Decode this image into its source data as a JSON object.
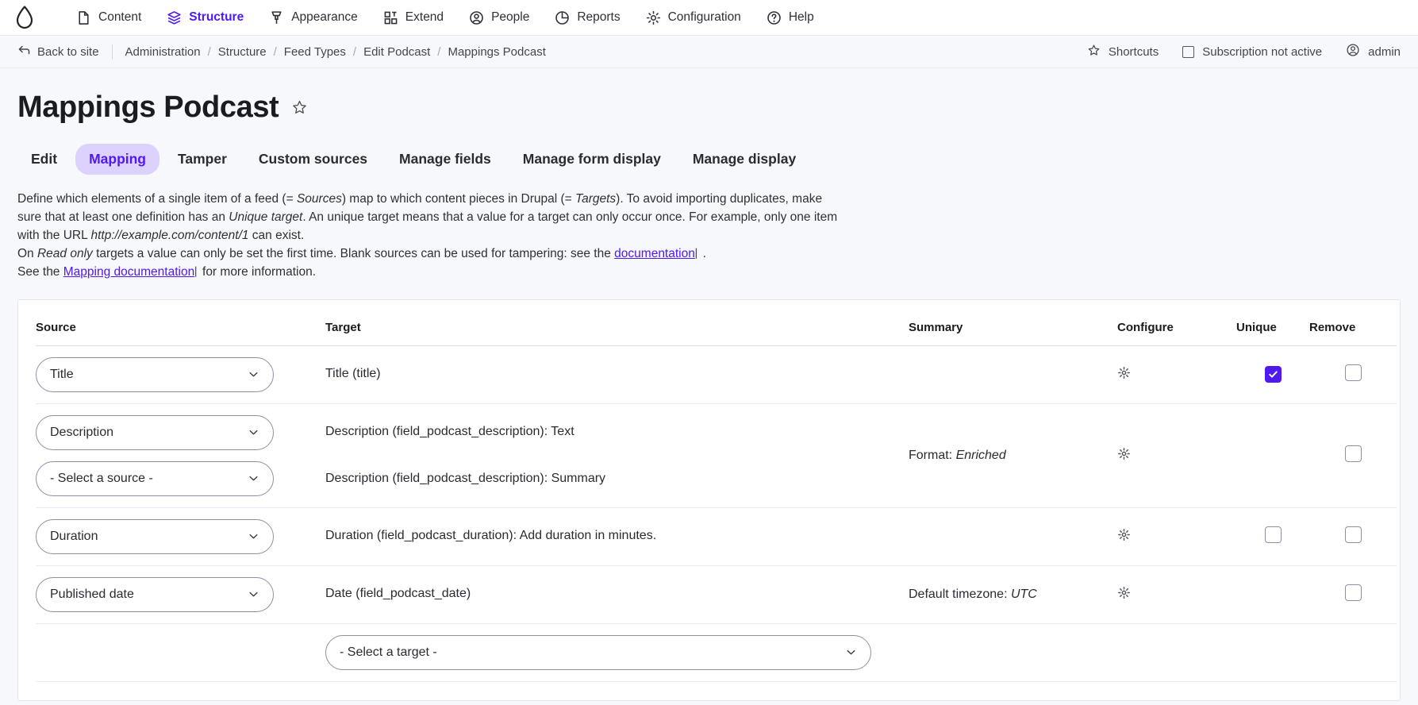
{
  "toolbar": {
    "logo_name": "drupal-droplet-logo",
    "items": [
      {
        "label": "Content",
        "icon": "document-icon",
        "active": false
      },
      {
        "label": "Structure",
        "icon": "layers-icon",
        "active": true
      },
      {
        "label": "Appearance",
        "icon": "paintbrush-icon",
        "active": false
      },
      {
        "label": "Extend",
        "icon": "blocks-icon",
        "active": false
      },
      {
        "label": "People",
        "icon": "person-circle-icon",
        "active": false
      },
      {
        "label": "Reports",
        "icon": "pie-chart-icon",
        "active": false
      },
      {
        "label": "Configuration",
        "icon": "gear-icon",
        "active": false
      },
      {
        "label": "Help",
        "icon": "question-circle-icon",
        "active": false
      }
    ]
  },
  "breadcrumb": {
    "back_label": "Back to site",
    "items": [
      "Administration",
      "Structure",
      "Feed Types",
      "Edit Podcast",
      "Mappings Podcast"
    ],
    "separator": "/",
    "shortcuts_label": "Shortcuts",
    "subscription_label": "Subscription not active",
    "user_label": "admin"
  },
  "page": {
    "title": "Mappings Podcast",
    "star_icon": "star-outline-icon"
  },
  "tabs": [
    {
      "label": "Edit",
      "active": false
    },
    {
      "label": "Mapping",
      "active": true
    },
    {
      "label": "Tamper",
      "active": false
    },
    {
      "label": "Custom sources",
      "active": false
    },
    {
      "label": "Manage fields",
      "active": false
    },
    {
      "label": "Manage form display",
      "active": false
    },
    {
      "label": "Manage display",
      "active": false
    }
  ],
  "intro": {
    "line1_a": "Define which elements of a single item of a feed (= ",
    "line1_em1": "Sources",
    "line1_b": ") map to which content pieces in Drupal (= ",
    "line1_em2": "Targets",
    "line1_c": "). To avoid importing duplicates, make sure that at least one definition has an ",
    "line1_em3": "Unique target",
    "line1_d": ". An unique target means that a value for a target can only occur once. For example, only one item with the URL ",
    "line1_em4": "http://example.com/content/1",
    "line1_e": " can exist.",
    "line2_a": "On ",
    "line2_em1": "Read only",
    "line2_b": " targets a value can only be set the first time. Blank sources can be used for tampering: see the ",
    "line2_link": "documentation",
    "line2_c": " .",
    "line3_a": "See the ",
    "line3_link": "Mapping documentation",
    "line3_b": "  for more information."
  },
  "table": {
    "headers": {
      "source": "Source",
      "target": "Target",
      "summary": "Summary",
      "configure": "Configure",
      "unique": "Unique",
      "remove": "Remove"
    },
    "rows": [
      {
        "sources": [
          "Title"
        ],
        "targets": [
          "Title (title)"
        ],
        "summary_label": "",
        "summary_value": "",
        "configure_icon": "gear-icon",
        "unique_checked": true,
        "unique_present": true,
        "remove_checked": false
      },
      {
        "sources": [
          "Description",
          "- Select a source -"
        ],
        "targets": [
          "Description (field_podcast_description): Text",
          "Description (field_podcast_description): Summary"
        ],
        "summary_label": "Format:",
        "summary_value": "Enriched",
        "configure_icon": "gear-icon",
        "unique_checked": false,
        "unique_present": false,
        "remove_checked": false
      },
      {
        "sources": [
          "Duration"
        ],
        "targets": [
          "Duration (field_podcast_duration): Add duration in minutes."
        ],
        "summary_label": "",
        "summary_value": "",
        "configure_icon": "gear-icon",
        "unique_checked": false,
        "unique_present": true,
        "remove_checked": false
      },
      {
        "sources": [
          "Published date"
        ],
        "targets": [
          "Date (field_podcast_date)"
        ],
        "summary_label": "Default timezone:",
        "summary_value": "UTC",
        "configure_icon": "gear-icon",
        "unique_checked": false,
        "unique_present": false,
        "remove_checked": false
      }
    ],
    "add_target_placeholder": "- Select a target -"
  },
  "colors": {
    "accent": "#5019f0",
    "tab_active_bg": "#ddd2fd",
    "page_bg": "#f7f8fc",
    "panel_bg": "#ffffff",
    "border": "#e3e4ee"
  }
}
